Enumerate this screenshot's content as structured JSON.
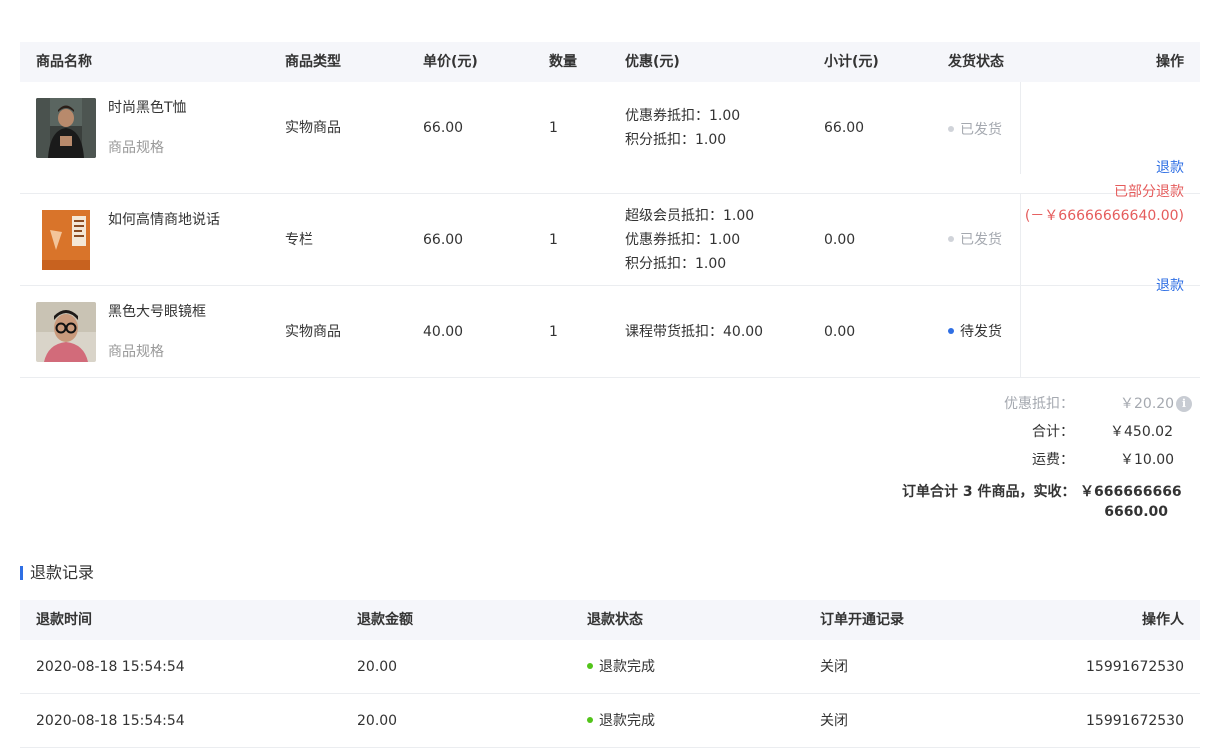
{
  "order_table": {
    "headers": {
      "name": "商品名称",
      "type": "商品类型",
      "price": "单价(元)",
      "qty": "数量",
      "discount": "优惠(元)",
      "subtotal": "小计(元)",
      "ship": "发货状态",
      "action": "操作"
    },
    "rows": [
      {
        "name": "时尚黑色T恤",
        "spec": "商品规格",
        "type": "实物商品",
        "price": "66.00",
        "qty": "1",
        "discounts": [
          "优惠券抵扣：1.00",
          "积分抵扣：1.00"
        ],
        "subtotal": "66.00",
        "ship_status": "已发货",
        "image": "man-in-black-tshirt-photo"
      },
      {
        "name": "如何高情商地说话",
        "spec": "",
        "type": "专栏",
        "price": "66.00",
        "qty": "1",
        "discounts": [
          "超级会员抵扣：1.00",
          "优惠券抵扣：1.00",
          "积分抵扣：1.00"
        ],
        "subtotal": "0.00",
        "ship_status": "已发货",
        "image": "orange-book-cover"
      },
      {
        "name": "黑色大号眼镜框",
        "spec": "商品规格",
        "type": "实物商品",
        "price": "40.00",
        "qty": "1",
        "discounts": [
          "课程带货抵扣：40.00"
        ],
        "subtotal": "0.00",
        "ship_status": "待发货",
        "image": "man-with-glasses-photo"
      }
    ],
    "actions": {
      "group1": {
        "refund": "退款",
        "partial": "已部分退款",
        "partial_amount": "(－￥66666666640.00)"
      },
      "group2": {
        "refund": "退款"
      }
    }
  },
  "summary": {
    "discount_label": "优惠抵扣：",
    "discount_value": "￥20.20",
    "total_label": "合计：",
    "total_value": "￥450.02",
    "shipping_label": "运费：",
    "shipping_value": "￥10.00",
    "paid_label": "订单合计 3 件商品，实收：",
    "paid_value_line1": "￥666666666",
    "paid_value_line2": "6660.00"
  },
  "refund_section": {
    "title": "退款记录",
    "headers": {
      "time": "退款时间",
      "amount": "退款金额",
      "status": "退款状态",
      "record": "订单开通记录",
      "operator": "操作人"
    },
    "rows": [
      {
        "time": "2020-08-18 15:54:54",
        "amount": "20.00",
        "status": "退款完成",
        "record": "关闭",
        "operator": "15991672530"
      },
      {
        "time": "2020-08-18 15:54:54",
        "amount": "20.00",
        "status": "退款完成",
        "record": "关闭",
        "operator": "15991672530"
      }
    ]
  },
  "colors": {
    "link": "#2f6fe4",
    "danger": "#e55c5c",
    "shipped_dot": "#d0d3d9",
    "pending_dot": "#2f6fe4",
    "success_dot": "#52c41a"
  }
}
